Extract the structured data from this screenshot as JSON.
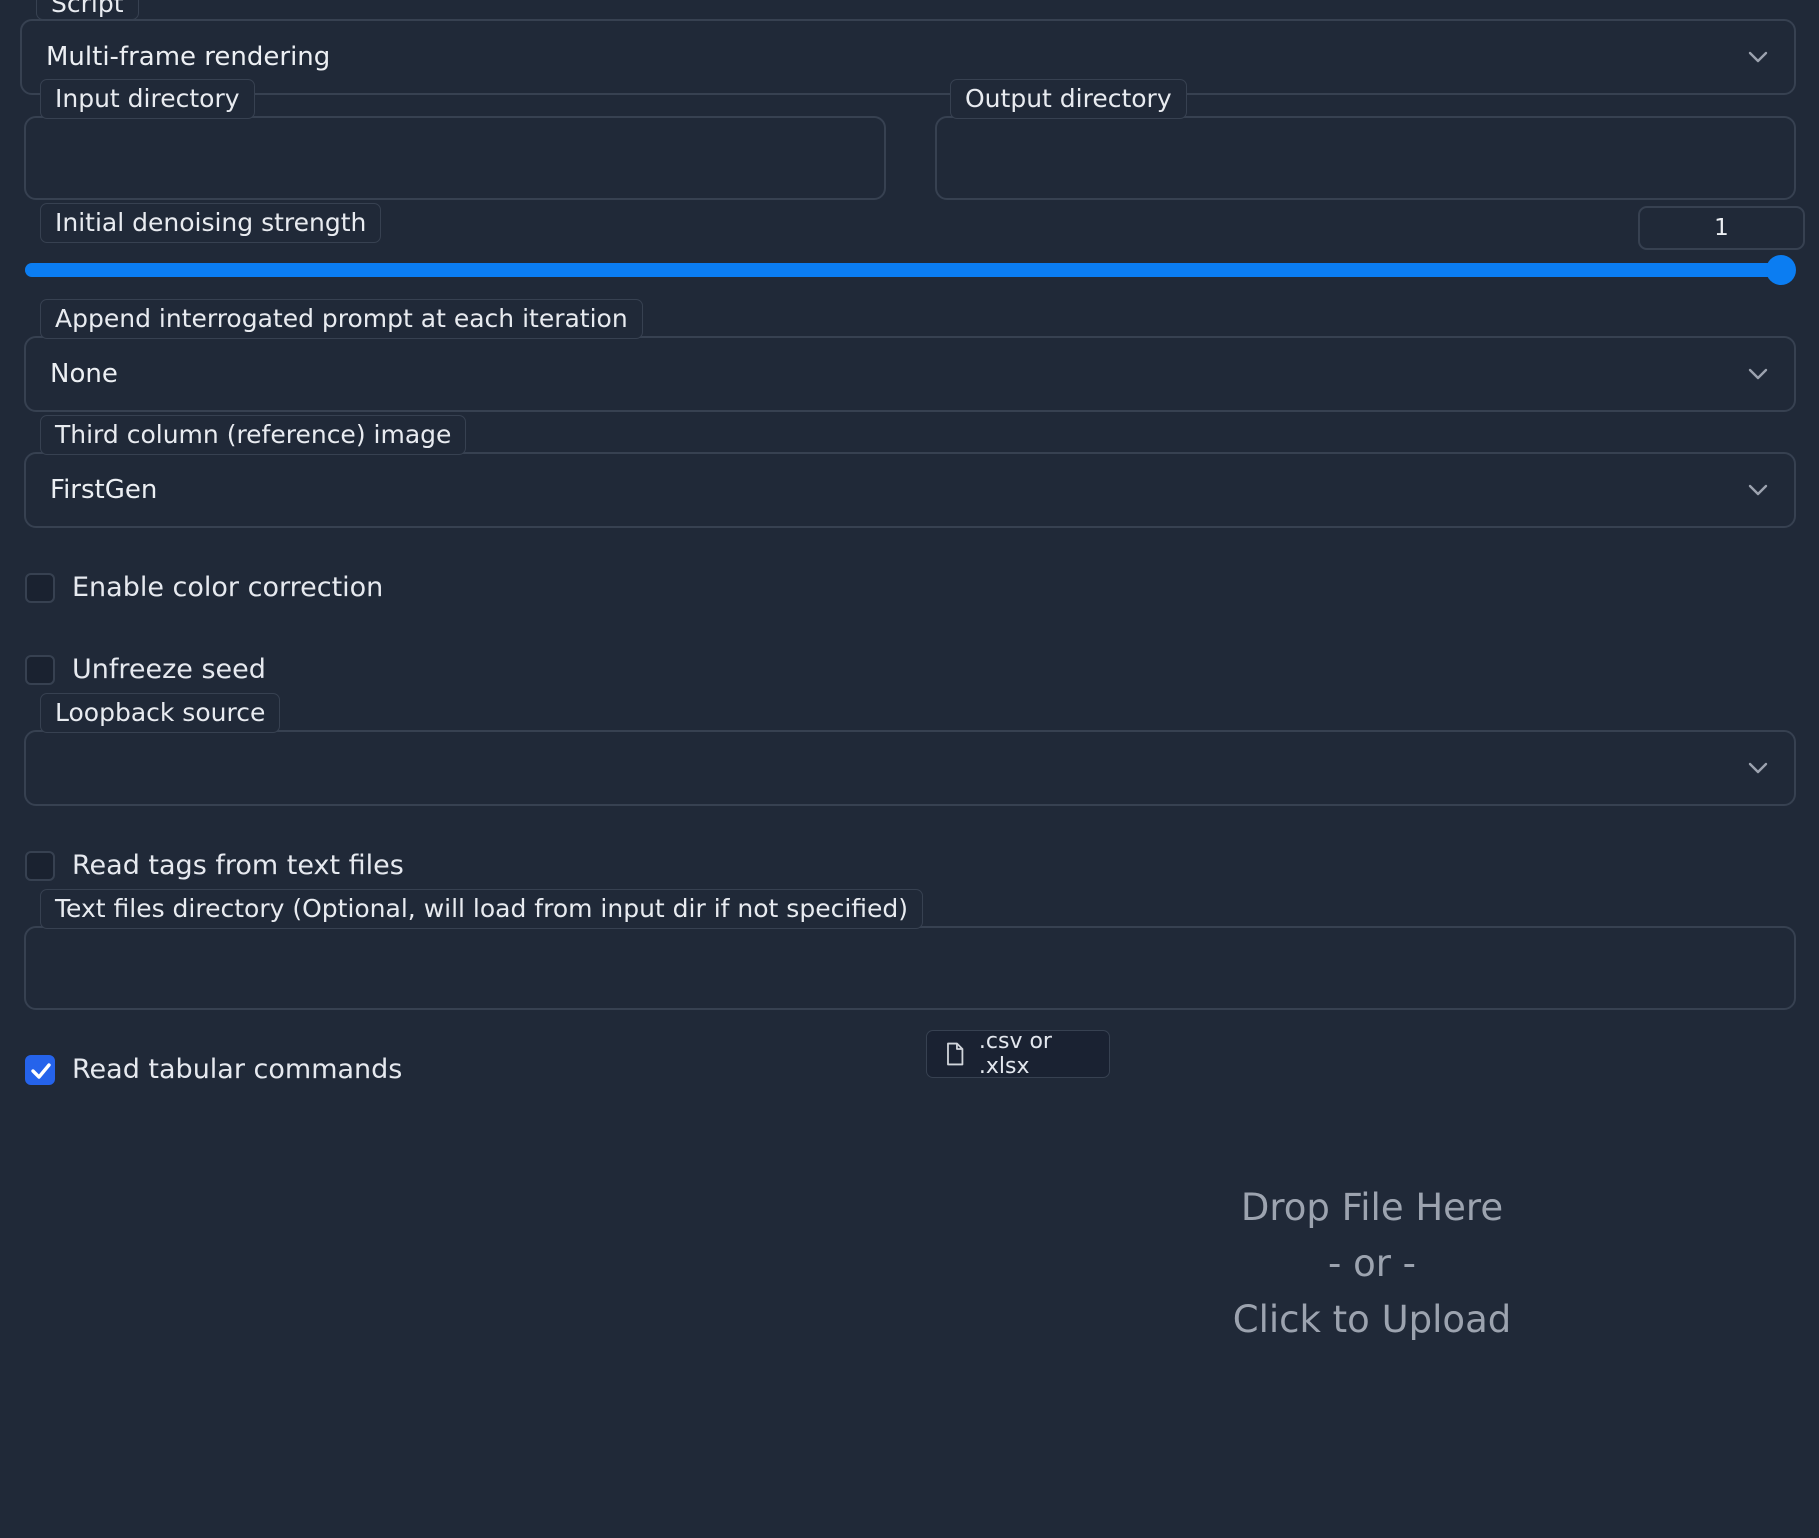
{
  "script": {
    "label": "Script",
    "value": "Multi-frame rendering"
  },
  "input_directory": {
    "label": "Input directory",
    "value": ""
  },
  "output_directory": {
    "label": "Output directory",
    "value": ""
  },
  "denoising": {
    "label": "Initial denoising strength",
    "value": "1",
    "fill_fraction": 1.0
  },
  "append_prompt": {
    "label": "Append interrogated prompt at each iteration",
    "value": "None"
  },
  "reference_image": {
    "label": "Third column (reference) image",
    "value": "FirstGen"
  },
  "color_correction": {
    "label": "Enable color correction",
    "checked": false
  },
  "unfreeze_seed": {
    "label": "Unfreeze seed",
    "checked": false
  },
  "loopback_source": {
    "label": "Loopback source",
    "value": ""
  },
  "read_tags": {
    "label": "Read tags from text files",
    "checked": false
  },
  "text_files_dir": {
    "label": "Text files directory (Optional, will load from input dir if not specified)",
    "value": ""
  },
  "tabular_commands": {
    "label": "Read tabular commands",
    "checked": true
  },
  "file_upload": {
    "accept_label": ".csv or .xlsx",
    "drop_line1": "Drop File Here",
    "drop_line2": "- or -",
    "drop_line3": "Click to Upload"
  },
  "icons": {
    "chevron": "chevron-down-icon",
    "file": "file-icon",
    "check": "checkmark-icon"
  },
  "colors": {
    "background": "#202938",
    "border": "#374151",
    "accent": "#0b7df2",
    "checkbox_checked": "#2563eb"
  }
}
